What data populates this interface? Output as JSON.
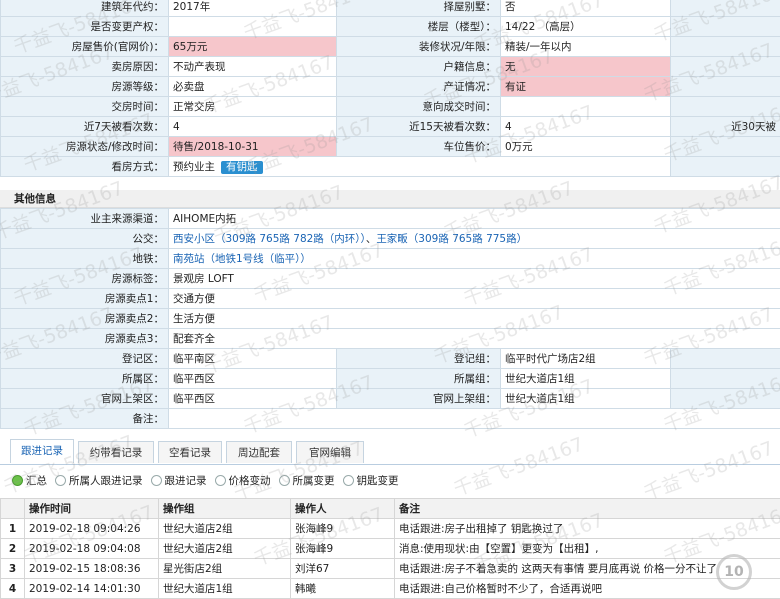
{
  "info_rows": [
    {
      "l1": "建筑年代约：",
      "v1": "2017年",
      "l2": "择屋别墅：",
      "v2": "否",
      "p1": false,
      "p2": false
    },
    {
      "l1": "是否变更产权：",
      "v1": "",
      "l2": "楼层（楼型）：",
      "v2": "14/22 （高层）",
      "p1": false,
      "p2": false
    },
    {
      "l1": "房屋售价(官网价)：",
      "v1": "65万元",
      "l2": "装修状况/年限：",
      "v2": "精装/一年以内",
      "p1": true,
      "p2": false
    },
    {
      "l1": "卖房原因：",
      "v1": "不动产表现",
      "l2": "户籍信息：",
      "v2": "无",
      "p1": false,
      "p2": true
    },
    {
      "l1": "房源等级：",
      "v1": "必卖盘",
      "l2": "产证情况：",
      "v2": "有证",
      "p1": false,
      "p2": true
    },
    {
      "l1": "交房时间：",
      "v1": "正常交房",
      "l2": "意向成交时间：",
      "v2": "",
      "p1": false,
      "p2": false
    },
    {
      "l1": "近7天被看次数：",
      "v1": "4",
      "l2": "近15天被看次数：",
      "v2": "4",
      "l3": "近30天被",
      "p1": false,
      "p2": false
    },
    {
      "l1": "房源状态/修改时间：",
      "v1": "待售/2018-10-31",
      "l2": "车位售价：",
      "v2": "0万元",
      "p1": true,
      "p2": false
    }
  ],
  "viewing": {
    "label": "看房方式：",
    "value": "预约业主",
    "badge": "有钥匙"
  },
  "section_title": "其他信息",
  "other": {
    "source_label": "业主来源渠道：",
    "source": "AIHOME内拓",
    "bus_label": "公交：",
    "bus_1": "西安小区（309路 765路 782路（内环））",
    "bus_sep": "、",
    "bus_2": "王家畈（309路 765路 775路）",
    "metro_label": "地铁：",
    "metro": "南苑站（地铁1号线（临平））",
    "tag_label": "房源标签：",
    "tag": "景观房 LOFT",
    "p1_label": "房源卖点1：",
    "p1": "交通方便",
    "p2_label": "房源卖点2：",
    "p2": "生活方便",
    "p3_label": "房源卖点3：",
    "p3": "配套齐全",
    "reg_area_label": "登记区：",
    "reg_area": "临平南区",
    "reg_group_label": "登记组：",
    "reg_group": "临平时代广场店2组",
    "own_area_label": "所属区：",
    "own_area": "临平西区",
    "own_group_label": "所属组：",
    "own_group": "世纪大道店1组",
    "web_area_label": "官网上架区：",
    "web_area": "临平西区",
    "web_group_label": "官网上架组：",
    "web_group": "世纪大道店1组",
    "remark_label": "备注：",
    "remark": ""
  },
  "tabs": [
    "跟进记录",
    "约带看记录",
    "空看记录",
    "周边配套",
    "官网编辑"
  ],
  "filters": [
    "汇总",
    "所属人跟进记录",
    "跟进记录",
    "价格变动",
    "所属变更",
    "钥匙变更"
  ],
  "log_headers": [
    "",
    "操作时间",
    "操作组",
    "操作人",
    "备注"
  ],
  "log_rows": [
    {
      "n": "1",
      "time": "2019-02-18 09:04:26",
      "group": "世纪大道店2组",
      "user": "张海峰9",
      "note": "电话跟进:房子出租掉了 钥匙换过了"
    },
    {
      "n": "2",
      "time": "2019-02-18 09:04:08",
      "group": "世纪大道店2组",
      "user": "张海峰9",
      "note": "消息:使用现状:由【空置】更变为【出租】,"
    },
    {
      "n": "3",
      "time": "2019-02-15 18:08:36",
      "group": "星光街店2组",
      "user": "刘洋67",
      "note": "电话跟进:房子不着急卖的 这两天有事情 要月底再说 价格一分不让了"
    },
    {
      "n": "4",
      "time": "2019-02-14 14:01:30",
      "group": "世纪大道店1组",
      "user": "韩曦",
      "note": "电话跟进:自己价格暂时不少了，合适再说吧"
    }
  ],
  "watermark": "千益飞-584167",
  "logo_text": "10"
}
